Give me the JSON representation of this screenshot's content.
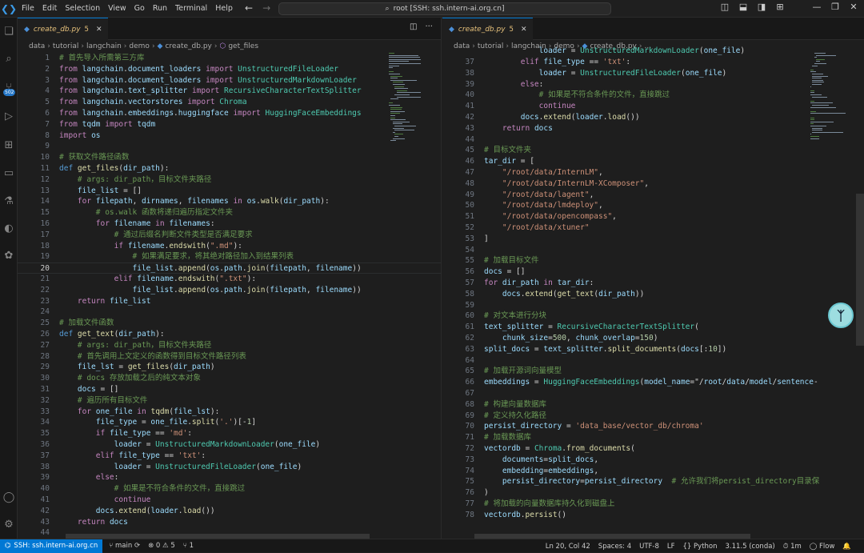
{
  "titlebar": {
    "menu": [
      "File",
      "Edit",
      "Selection",
      "View",
      "Go",
      "Run",
      "Terminal",
      "Help"
    ],
    "search": "root [SSH: ssh.intern-ai.org.cn]"
  },
  "activity": {
    "badge": "502"
  },
  "left": {
    "tab": {
      "name": "create_db.py",
      "mod": "5"
    },
    "breadcrumb": [
      "data",
      "tutorial",
      "langchain",
      "demo",
      "create_db.py",
      "get_files"
    ],
    "cursor_line": 20,
    "lines": [
      {
        "n": 1,
        "t": "# 首先导入所需第三方库",
        "k": "cm"
      },
      {
        "n": 2,
        "t": "from langchain.document_loaders import UnstructuredFileLoader"
      },
      {
        "n": 3,
        "t": "from langchain.document_loaders import UnstructuredMarkdownLoader"
      },
      {
        "n": 4,
        "t": "from langchain.text_splitter import RecursiveCharacterTextSplitter"
      },
      {
        "n": 5,
        "t": "from langchain.vectorstores import Chroma"
      },
      {
        "n": 6,
        "t": "from langchain.embeddings.huggingface import HuggingFaceEmbeddings"
      },
      {
        "n": 7,
        "t": "from tqdm import tqdm"
      },
      {
        "n": 8,
        "t": "import os"
      },
      {
        "n": 9,
        "t": ""
      },
      {
        "n": 10,
        "t": "# 获取文件路径函数",
        "k": "cm"
      },
      {
        "n": 11,
        "t": "def get_files(dir_path):"
      },
      {
        "n": 12,
        "t": "    # args: dir_path，目标文件夹路径",
        "k": "cm"
      },
      {
        "n": 13,
        "t": "    file_list = []"
      },
      {
        "n": 14,
        "t": "    for filepath, dirnames, filenames in os.walk(dir_path):"
      },
      {
        "n": 15,
        "t": "        # os.walk 函数将递归遍历指定文件夹",
        "k": "cm"
      },
      {
        "n": 16,
        "t": "        for filename in filenames:"
      },
      {
        "n": 17,
        "t": "            # 通过后缀名判断文件类型是否满足要求",
        "k": "cm"
      },
      {
        "n": 18,
        "t": "            if filename.endswith(\".md\"):"
      },
      {
        "n": 19,
        "t": "                # 如果满足要求，将其绝对路径加入到结果列表",
        "k": "cm"
      },
      {
        "n": 20,
        "t": "                file_list.append(os.path.join(filepath, filename))"
      },
      {
        "n": 21,
        "t": "            elif filename.endswith(\".txt\"):"
      },
      {
        "n": 22,
        "t": "                file_list.append(os.path.join(filepath, filename))"
      },
      {
        "n": 23,
        "t": "    return file_list"
      },
      {
        "n": 24,
        "t": ""
      },
      {
        "n": 25,
        "t": "# 加载文件函数",
        "k": "cm"
      },
      {
        "n": 26,
        "t": "def get_text(dir_path):"
      },
      {
        "n": 27,
        "t": "    # args: dir_path，目标文件夹路径",
        "k": "cm"
      },
      {
        "n": 28,
        "t": "    # 首先调用上文定义的函数得到目标文件路径列表",
        "k": "cm"
      },
      {
        "n": 29,
        "t": "    file_lst = get_files(dir_path)"
      },
      {
        "n": 30,
        "t": "    # docs 存放加载之后的纯文本对象",
        "k": "cm"
      },
      {
        "n": 31,
        "t": "    docs = []"
      },
      {
        "n": 32,
        "t": "    # 遍历所有目标文件",
        "k": "cm"
      },
      {
        "n": 33,
        "t": "    for one_file in tqdm(file_lst):"
      },
      {
        "n": 34,
        "t": "        file_type = one_file.split('.')[-1]"
      },
      {
        "n": 35,
        "t": "        if file_type == 'md':"
      },
      {
        "n": 36,
        "t": "            loader = UnstructuredMarkdownLoader(one_file)"
      },
      {
        "n": 37,
        "t": "        elif file_type == 'txt':"
      },
      {
        "n": 38,
        "t": "            loader = UnstructuredFileLoader(one_file)"
      },
      {
        "n": 39,
        "t": "        else:"
      },
      {
        "n": 40,
        "t": "            # 如果是不符合条件的文件，直接跳过",
        "k": "cm"
      },
      {
        "n": 41,
        "t": "            continue"
      },
      {
        "n": 42,
        "t": "        docs.extend(loader.load())"
      },
      {
        "n": 43,
        "t": "    return docs"
      },
      {
        "n": 44,
        "t": ""
      }
    ]
  },
  "right": {
    "tab": {
      "name": "create_db.py",
      "mod": "5"
    },
    "breadcrumb": [
      "data",
      "tutorial",
      "langchain",
      "demo",
      "create_db.py",
      "..."
    ],
    "partial_top": "            loader = UnstructuredMarkdownLoader(one_file)",
    "lines": [
      {
        "n": 37,
        "t": "        elif file_type == 'txt':"
      },
      {
        "n": 38,
        "t": "            loader = UnstructuredFileLoader(one_file)"
      },
      {
        "n": 39,
        "t": "        else:"
      },
      {
        "n": 40,
        "t": "            # 如果是不符合条件的文件，直接跳过",
        "k": "cm"
      },
      {
        "n": 41,
        "t": "            continue"
      },
      {
        "n": 42,
        "t": "        docs.extend(loader.load())"
      },
      {
        "n": 43,
        "t": "    return docs"
      },
      {
        "n": 44,
        "t": ""
      },
      {
        "n": 45,
        "t": "# 目标文件夹",
        "k": "cm"
      },
      {
        "n": 46,
        "t": "tar_dir = ["
      },
      {
        "n": 47,
        "t": "    \"/root/data/InternLM\","
      },
      {
        "n": 48,
        "t": "    \"/root/data/InternLM-XComposer\","
      },
      {
        "n": 49,
        "t": "    \"/root/data/lagent\","
      },
      {
        "n": 50,
        "t": "    \"/root/data/lmdeploy\","
      },
      {
        "n": 51,
        "t": "    \"/root/data/opencompass\","
      },
      {
        "n": 52,
        "t": "    \"/root/data/xtuner\""
      },
      {
        "n": 53,
        "t": "]"
      },
      {
        "n": 54,
        "t": ""
      },
      {
        "n": 55,
        "t": "# 加载目标文件",
        "k": "cm"
      },
      {
        "n": 56,
        "t": "docs = []"
      },
      {
        "n": 57,
        "t": "for dir_path in tar_dir:"
      },
      {
        "n": 58,
        "t": "    docs.extend(get_text(dir_path))"
      },
      {
        "n": 59,
        "t": ""
      },
      {
        "n": 60,
        "t": "# 对文本进行分块",
        "k": "cm"
      },
      {
        "n": 61,
        "t": "text_splitter = RecursiveCharacterTextSplitter("
      },
      {
        "n": 62,
        "t": "    chunk_size=500, chunk_overlap=150)"
      },
      {
        "n": 63,
        "t": "split_docs = text_splitter.split_documents(docs[:10])"
      },
      {
        "n": 64,
        "t": ""
      },
      {
        "n": 65,
        "t": "# 加载开源词向量模型",
        "k": "cm"
      },
      {
        "n": 66,
        "t": "embeddings = HuggingFaceEmbeddings(model_name=\"/root/data/model/sentence-"
      },
      {
        "n": 67,
        "t": ""
      },
      {
        "n": 68,
        "t": "# 构建向量数据库",
        "k": "cm"
      },
      {
        "n": 69,
        "t": "# 定义持久化路径",
        "k": "cm"
      },
      {
        "n": 70,
        "t": "persist_directory = 'data_base/vector_db/chroma'"
      },
      {
        "n": 71,
        "t": "# 加载数据库",
        "k": "cm"
      },
      {
        "n": 72,
        "t": "vectordb = Chroma.from_documents("
      },
      {
        "n": 73,
        "t": "    documents=split_docs,"
      },
      {
        "n": 74,
        "t": "    embedding=embeddings,"
      },
      {
        "n": 75,
        "t": "    persist_directory=persist_directory  # 允许我们将persist_directory目录保"
      },
      {
        "n": 76,
        "t": ")"
      },
      {
        "n": 77,
        "t": "# 将加载的向量数据库持久化到磁盘上",
        "k": "cm"
      },
      {
        "n": 78,
        "t": "vectordb.persist()"
      }
    ]
  },
  "status": {
    "remote": "SSH: ssh.intern-ai.org.cn",
    "branch": "main",
    "problems": "⊗ 0 ⚠ 5",
    "ports": "⑂ 1",
    "right": [
      "Ln 20, Col 42",
      "Spaces: 4",
      "UTF-8",
      "LF",
      "{} Python",
      "3.11.5 (conda)",
      "⏱ 1m",
      "◯ Flow",
      "🔔"
    ]
  }
}
